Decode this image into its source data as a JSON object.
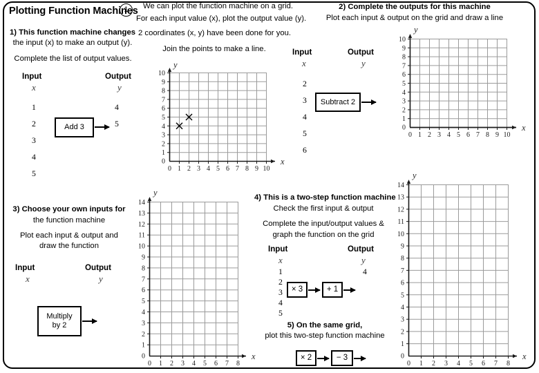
{
  "page": {
    "title": "Plotting Function Machines",
    "page_number": "1"
  },
  "intro": {
    "line1": "We can plot the function machine on a grid.",
    "line2": "For each input value (x), plot the output value (y).",
    "line3": "2 coordinates (x, y) have been done for you.",
    "line4": "Join the points to make a line."
  },
  "q1": {
    "line1": "1) This function machine changes",
    "line2": "the input (x) to make an output (y).",
    "line3": "Complete the list of output values.",
    "input_header": "Input",
    "input_var": "x",
    "output_header": "Output",
    "output_var": "y",
    "inputs": [
      "1",
      "2",
      "3",
      "4",
      "5"
    ],
    "outputs": [
      "4",
      "5",
      "",
      "",
      ""
    ],
    "machine_label": "Add 3"
  },
  "q2": {
    "line1": "2) Complete the outputs for this machine",
    "line2": "Plot each input & output on the grid and draw a line",
    "input_header": "Input",
    "input_var": "x",
    "output_header": "Output",
    "output_var": "y",
    "inputs": [
      "2",
      "3",
      "4",
      "5",
      "6"
    ],
    "outputs": [
      "",
      "",
      "",
      "",
      ""
    ],
    "machine_label": "Subtract 2"
  },
  "q3": {
    "line1": "3) Choose your own inputs for",
    "line2": "the function machine",
    "line3": "Plot each input & output and",
    "line4": "draw the function",
    "input_header": "Input",
    "input_var": "x",
    "output_header": "Output",
    "output_var": "y",
    "machine_label_line1": "Multiply",
    "machine_label_line2": "by  2"
  },
  "q4": {
    "line1": "4) This is a two-step function machine",
    "line2": "Check the first input & output",
    "line3": "Complete the input/output values &",
    "line4": "graph the function on the grid",
    "input_header": "Input",
    "input_var": "x",
    "output_header": "Output",
    "output_var": "y",
    "inputs": [
      "1",
      "2",
      "3",
      "4",
      "5"
    ],
    "outputs": [
      "4",
      "",
      "",
      "",
      ""
    ],
    "machine1_label": "× 3",
    "machine2_label": "+ 1"
  },
  "q5": {
    "line1": "5) On the same grid,",
    "line2": "plot this two-step function machine",
    "machine1_label": "× 2",
    "machine2_label": "− 3"
  },
  "colors": {
    "grid_line": "#9a9a9a",
    "axis": "#1a1a1a",
    "border": "#000000"
  },
  "chart_data": [
    {
      "id": "grid-q1",
      "type": "scatter",
      "title": "",
      "xlabel": "x",
      "ylabel": "y",
      "xlim": [
        0,
        10
      ],
      "ylim": [
        0,
        10
      ],
      "xticks": [
        "0",
        "1",
        "2",
        "3",
        "4",
        "5",
        "6",
        "7",
        "8",
        "9",
        "10"
      ],
      "yticks": [
        "0",
        "1",
        "2",
        "3",
        "4",
        "5",
        "6",
        "7",
        "8",
        "9",
        "10"
      ],
      "grid": true,
      "marker": "x",
      "points": [
        {
          "x": 1,
          "y": 4
        },
        {
          "x": 2,
          "y": 5
        }
      ]
    },
    {
      "id": "grid-q2",
      "type": "scatter",
      "title": "",
      "xlabel": "x",
      "ylabel": "y",
      "xlim": [
        0,
        10
      ],
      "ylim": [
        0,
        10
      ],
      "xticks": [
        "0",
        "1",
        "2",
        "3",
        "4",
        "5",
        "6",
        "7",
        "8",
        "9",
        "10"
      ],
      "yticks": [
        "0",
        "1",
        "2",
        "3",
        "4",
        "5",
        "6",
        "7",
        "8",
        "9",
        "10"
      ],
      "grid": true,
      "points": []
    },
    {
      "id": "grid-q3",
      "type": "scatter",
      "title": "",
      "xlabel": "x",
      "ylabel": "y",
      "xlim": [
        0,
        8
      ],
      "ylim": [
        0,
        14
      ],
      "xticks": [
        "0",
        "1",
        "2",
        "3",
        "4",
        "5",
        "6",
        "7",
        "8"
      ],
      "yticks": [
        "0",
        "1",
        "2",
        "3",
        "4",
        "5",
        "6",
        "7",
        "8",
        "9",
        "10",
        "11",
        "12",
        "13",
        "14"
      ],
      "grid": true,
      "points": []
    },
    {
      "id": "grid-q4",
      "type": "scatter",
      "title": "",
      "xlabel": "x",
      "ylabel": "y",
      "xlim": [
        0,
        8
      ],
      "ylim": [
        0,
        14
      ],
      "xticks": [
        "0",
        "1",
        "2",
        "3",
        "4",
        "5",
        "6",
        "7",
        "8"
      ],
      "yticks": [
        "0",
        "1",
        "2",
        "3",
        "4",
        "5",
        "6",
        "7",
        "8",
        "9",
        "10",
        "11",
        "12",
        "13",
        "14"
      ],
      "grid": true,
      "points": []
    }
  ]
}
